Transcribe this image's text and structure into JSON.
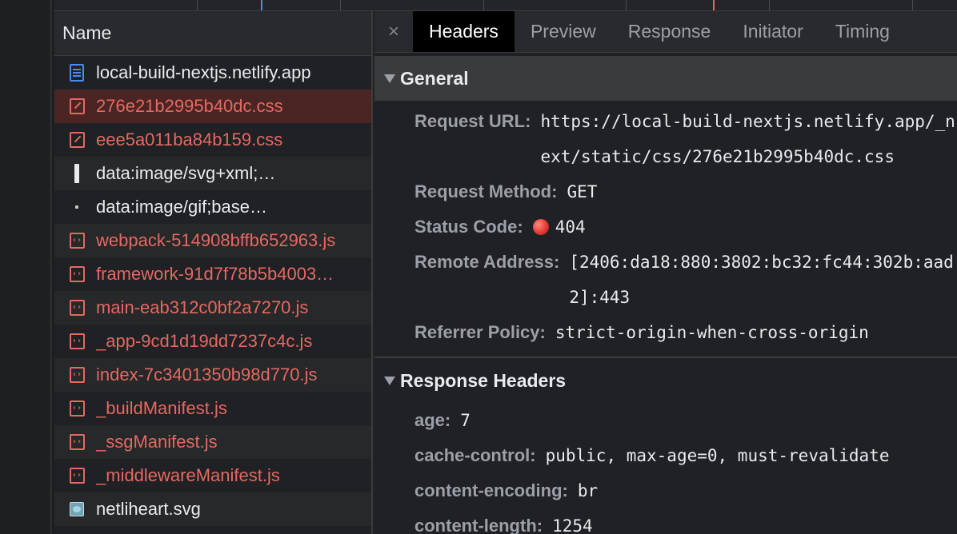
{
  "request_list": {
    "header": "Name",
    "rows": [
      {
        "name": "local-build-nextjs.netlify.app",
        "icon": "document-icon",
        "status": "ok"
      },
      {
        "name": "276e21b2995b40dc.css",
        "icon": "css-file-icon",
        "status": "error"
      },
      {
        "name": "eee5a011ba84b159.css",
        "icon": "css-file-icon",
        "status": "error"
      },
      {
        "name": "data:image/svg+xml;…",
        "icon": "svg-image-icon",
        "status": "ok"
      },
      {
        "name": "data:image/gif;base…",
        "icon": "gif-image-icon",
        "status": "ok"
      },
      {
        "name": "webpack-514908bffb652963.js",
        "icon": "script-file-icon",
        "status": "error"
      },
      {
        "name": "framework-91d7f78b5b4003…",
        "icon": "script-file-icon",
        "status": "error"
      },
      {
        "name": "main-eab312c0bf2a7270.js",
        "icon": "script-file-icon",
        "status": "error"
      },
      {
        "name": "_app-9cd1d19dd7237c4c.js",
        "icon": "script-file-icon",
        "status": "error"
      },
      {
        "name": "index-7c3401350b98d770.js",
        "icon": "script-file-icon",
        "status": "error"
      },
      {
        "name": "_buildManifest.js",
        "icon": "script-file-icon",
        "status": "error"
      },
      {
        "name": "_ssgManifest.js",
        "icon": "script-file-icon",
        "status": "error"
      },
      {
        "name": "_middlewareManifest.js",
        "icon": "script-file-icon",
        "status": "error"
      },
      {
        "name": "netliheart.svg",
        "icon": "image-file-icon",
        "status": "ok"
      }
    ]
  },
  "tabs": {
    "close": "×",
    "items": [
      {
        "label": "Headers",
        "active": true
      },
      {
        "label": "Preview",
        "active": false
      },
      {
        "label": "Response",
        "active": false
      },
      {
        "label": "Initiator",
        "active": false
      },
      {
        "label": "Timing",
        "active": false
      }
    ]
  },
  "general": {
    "title": "General",
    "request_url_label": "Request URL:",
    "request_url": "https://local-build-nextjs.netlify.app/_next/static/css/276e21b2995b40dc.css",
    "request_method_label": "Request Method:",
    "request_method": "GET",
    "status_code_label": "Status Code:",
    "status_code": "404",
    "remote_address_label": "Remote Address:",
    "remote_address": "[2406:da18:880:3802:bc32:fc44:302b:aad2]:443",
    "referrer_policy_label": "Referrer Policy:",
    "referrer_policy": "strict-origin-when-cross-origin"
  },
  "response_headers": {
    "title": "Response Headers",
    "items": [
      {
        "key": "age:",
        "value": "7"
      },
      {
        "key": "cache-control:",
        "value": "public, max-age=0, must-revalidate"
      },
      {
        "key": "content-encoding:",
        "value": "br"
      },
      {
        "key": "content-length:",
        "value": "1254"
      }
    ]
  },
  "colors": {
    "error_text": "#e46962",
    "selected_row": "#4b2524",
    "active_tab_bg": "#000000",
    "doc_icon": "#4a8af4"
  }
}
